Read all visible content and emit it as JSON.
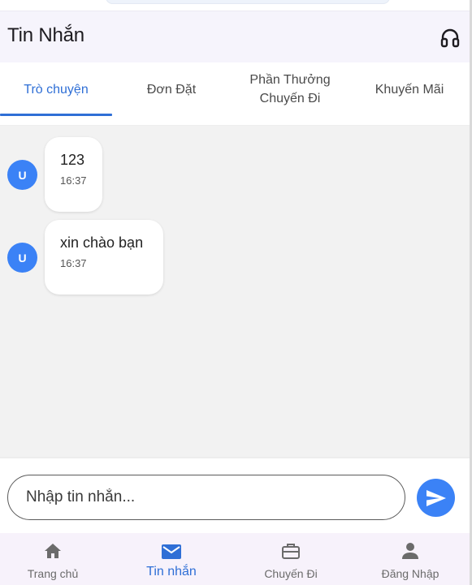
{
  "header": {
    "title": "Tin Nhắn",
    "support_icon": "headset-icon"
  },
  "tabs": [
    {
      "label": "Trò chuyện",
      "active": true
    },
    {
      "label": "Đơn Đặt",
      "active": false
    },
    {
      "label_line1": "Phần Thưởng",
      "label_line2": "Chuyến Đi",
      "active": false
    },
    {
      "label": "Khuyến Mãi",
      "active": false
    }
  ],
  "messages": [
    {
      "avatar": "U",
      "text": "123",
      "time": "16:37"
    },
    {
      "avatar": "U",
      "text": "xin chào bạn",
      "time": "16:37"
    }
  ],
  "composer": {
    "placeholder": "Nhập tin nhắn...",
    "value": "",
    "send_icon": "send-icon"
  },
  "bottom_nav": [
    {
      "label": "Trang chủ",
      "icon": "home-icon",
      "active": false
    },
    {
      "label": "Tin nhắn",
      "icon": "mail-icon",
      "active": true
    },
    {
      "label": "Chuyến Đi",
      "icon": "briefcase-icon",
      "active": false
    },
    {
      "label": "Đăng Nhập",
      "icon": "person-icon",
      "active": false
    }
  ],
  "colors": {
    "accent": "#2f6fd6",
    "avatar_bg": "#3b82f6",
    "chat_bg": "#f2f2f2",
    "nav_bg": "#f7f2fb"
  }
}
